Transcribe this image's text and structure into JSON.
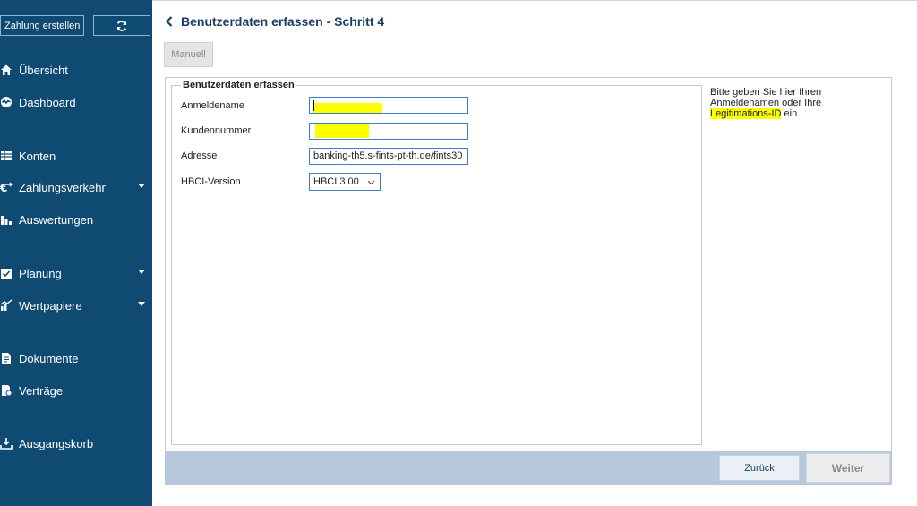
{
  "sidebar": {
    "zahlung_button": "Zahlung erstellen",
    "refresh_icon": "refresh-icon",
    "items": [
      {
        "label": "Übersicht",
        "icon": "home-icon"
      },
      {
        "label": "Dashboard",
        "icon": "dashboard-icon"
      },
      {
        "label": "Konten",
        "icon": "list-icon"
      },
      {
        "label": "Zahlungsverkehr",
        "icon": "transfer-icon",
        "expandable": true
      },
      {
        "label": "Auswertungen",
        "icon": "bar-chart-icon"
      },
      {
        "label": "Planung",
        "icon": "calendar-check-icon",
        "expandable": true
      },
      {
        "label": "Wertpapiere",
        "icon": "stocks-icon",
        "expandable": true
      },
      {
        "label": "Dokumente",
        "icon": "document-icon"
      },
      {
        "label": "Verträge",
        "icon": "contract-icon"
      },
      {
        "label": "Ausgangskorb",
        "icon": "outbox-icon"
      }
    ]
  },
  "header": {
    "title": "Benutzerdaten erfassen - Schritt 4",
    "manual_button": "Manuell"
  },
  "form": {
    "legend": "Benutzerdaten erfassen",
    "fields": {
      "anmeldename": {
        "label": "Anmeldename",
        "value": ""
      },
      "kundennummer": {
        "label": "Kundennummer",
        "value": ""
      },
      "adresse": {
        "label": "Adresse",
        "value": "banking-th5.s-fints-pt-th.de/fints30"
      },
      "hbci": {
        "label": "HBCI-Version",
        "value": "HBCI 3.00"
      }
    }
  },
  "help": {
    "line1": "Bitte geben Sie hier Ihren",
    "line2": "Anmeldenamen oder Ihre",
    "highlight": "Legitimations-ID",
    "suffix": " ein."
  },
  "footer": {
    "back_button": "Zurück",
    "next_button": "Weiter"
  },
  "colors": {
    "sidebar": "#0f4a73",
    "accent": "#1b3f63",
    "highlight": "#fbff00",
    "footer": "#b6c8dc"
  }
}
